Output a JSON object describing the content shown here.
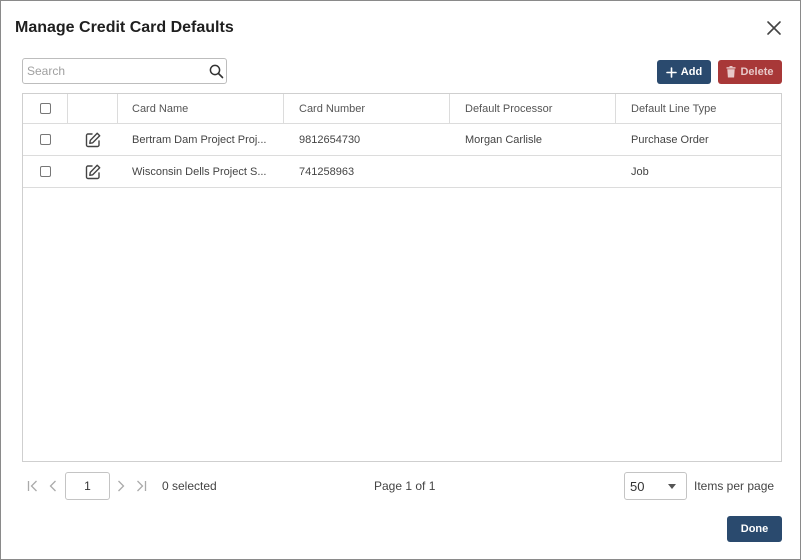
{
  "dialog": {
    "title": "Manage Credit Card Defaults"
  },
  "toolbar": {
    "search_placeholder": "Search",
    "search_value": "",
    "add_label": "Add",
    "delete_label": "Delete"
  },
  "grid": {
    "columns": [
      "Card Name",
      "Card Number",
      "Default Processor",
      "Default Line Type"
    ],
    "rows": [
      {
        "card_name": "Bertram Dam Project Proj...",
        "card_number": "9812654730",
        "default_processor": "Morgan Carlisle",
        "default_line_type": "Purchase Order"
      },
      {
        "card_name": "Wisconsin Dells Project S...",
        "card_number": "741258963",
        "default_processor": "",
        "default_line_type": "Job"
      }
    ]
  },
  "pager": {
    "current_page": "1",
    "selected_text": "0 selected",
    "page_info": "Page 1 of 1",
    "items_per_page": "50",
    "items_per_page_label": "Items per page"
  },
  "footer": {
    "done_label": "Done"
  },
  "colors": {
    "primary": "#2a4a6e",
    "danger": "#a83838"
  }
}
